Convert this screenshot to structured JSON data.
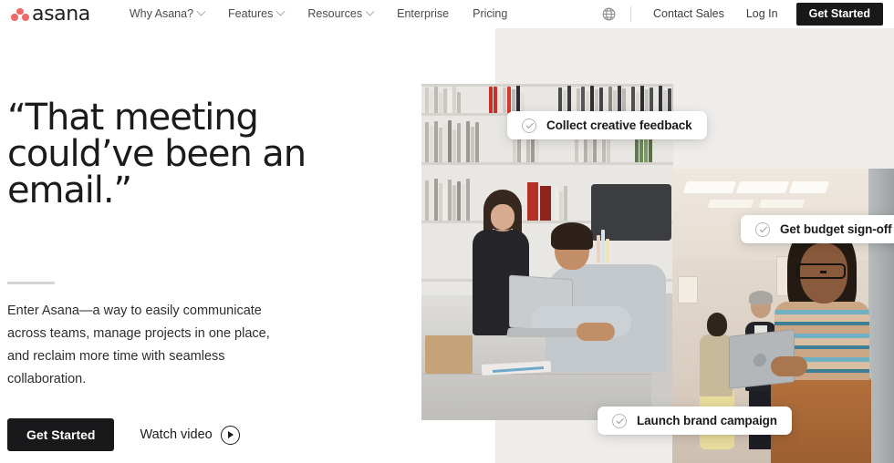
{
  "brand": {
    "name": "asana",
    "logo_icon": "asana-dots-logo",
    "accent_color": "#F06A6A",
    "dark_color": "#19181A"
  },
  "nav": {
    "links": [
      {
        "label": "Why Asana?",
        "has_dropdown": true
      },
      {
        "label": "Features",
        "has_dropdown": true
      },
      {
        "label": "Resources",
        "has_dropdown": true
      },
      {
        "label": "Enterprise",
        "has_dropdown": false
      },
      {
        "label": "Pricing",
        "has_dropdown": false
      }
    ],
    "language_icon": "globe-icon",
    "contact_sales": "Contact Sales",
    "log_in": "Log In",
    "get_started": "Get Started"
  },
  "hero": {
    "headline": "“That meeting could’ve been an email.”",
    "subcopy": "Enter Asana—a way to easily communicate across teams, manage projects in one place, and reclaim more time with seamless collaboration.",
    "primary_cta": "Get Started",
    "secondary_cta": "Watch video",
    "secondary_cta_icon": "play-circle-icon"
  },
  "task_pills": [
    {
      "label": "Collect creative feedback",
      "icon": "check-circle-icon"
    },
    {
      "label": "Get budget sign-off",
      "icon": "check-circle-icon"
    },
    {
      "label": "Launch brand campaign",
      "icon": "check-circle-icon"
    }
  ],
  "media": {
    "panel_color": "#EFEDEB",
    "photo_a_alt": "two colleagues working at a desk with a laptop in a design studio",
    "photo_b_alt": "woman holding a laptop in an open office with coworkers in the background"
  }
}
